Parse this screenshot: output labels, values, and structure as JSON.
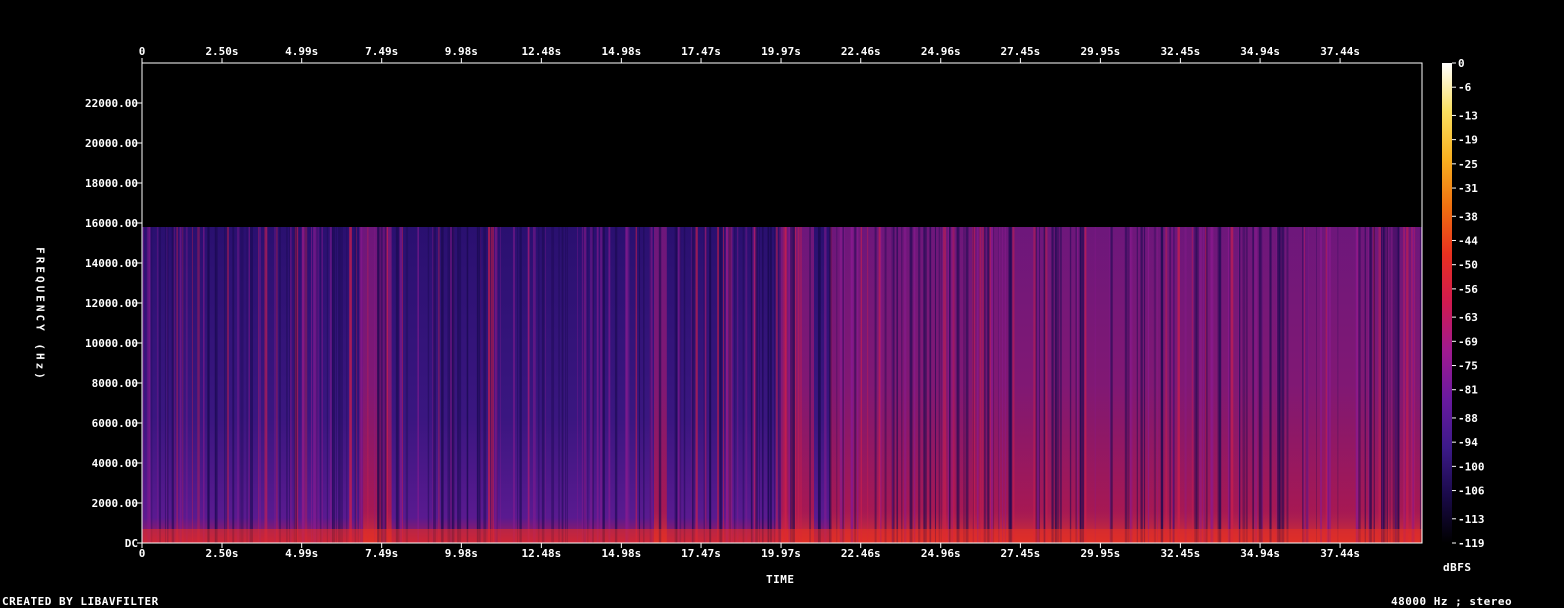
{
  "chart_data": {
    "type": "heatmap",
    "title": "",
    "xlabel": "TIME",
    "ylabel": "FREQUENCY (Hz)",
    "x_ticks": [
      "0",
      "2.50s",
      "4.99s",
      "7.49s",
      "9.98s",
      "12.48s",
      "14.98s",
      "17.47s",
      "19.97s",
      "22.46s",
      "24.96s",
      "27.45s",
      "29.95s",
      "32.45s",
      "34.94s",
      "37.44s"
    ],
    "y_ticks": [
      "DC",
      "2000.00",
      "4000.00",
      "6000.00",
      "8000.00",
      "10000.00",
      "12000.00",
      "14000.00",
      "16000.00",
      "18000.00",
      "20000.00",
      "22000.00"
    ],
    "y_tick_values": [
      0,
      2000,
      4000,
      6000,
      8000,
      10000,
      12000,
      14000,
      16000,
      18000,
      20000,
      22000
    ],
    "x_tick_values": [
      0,
      2.5,
      4.99,
      7.49,
      9.98,
      12.48,
      14.98,
      17.47,
      19.97,
      22.46,
      24.96,
      27.45,
      29.95,
      32.45,
      34.94,
      37.44
    ],
    "xlim": [
      0,
      40
    ],
    "ylim": [
      0,
      24000
    ],
    "cutoff_hz": 15800,
    "colorbar": {
      "label": "dBFS",
      "ticks": [
        "0",
        "-6",
        "-13",
        "-19",
        "-25",
        "-31",
        "-38",
        "-44",
        "-50",
        "-56",
        "-63",
        "-69",
        "-75",
        "-81",
        "-88",
        "-94",
        "-100",
        "-106",
        "-113",
        "-119"
      ],
      "range": [
        -119,
        0
      ],
      "colors": [
        "#000000",
        "#1a0a4a",
        "#3d1a8a",
        "#6a1aa0",
        "#a01a90",
        "#d01a50",
        "#e83020",
        "#f07010",
        "#f8b020",
        "#fae060",
        "#ffffff"
      ]
    },
    "loud_segments_s": [
      [
        6.8,
        7.8
      ],
      [
        16.0,
        16.4
      ],
      [
        19.9,
        21.0
      ],
      [
        21.5,
        40.0
      ]
    ],
    "footer_left": "CREATED BY LIBAVFILTER",
    "footer_right": "48000 Hz ; stereo"
  }
}
